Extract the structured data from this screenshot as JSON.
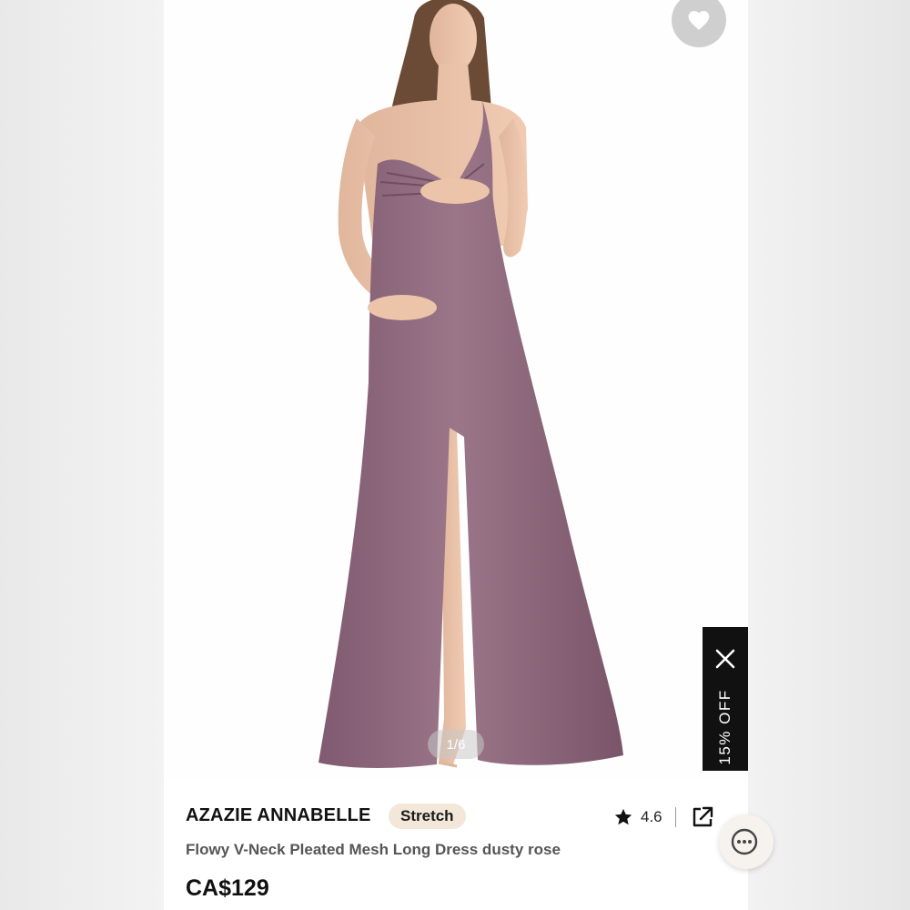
{
  "image_counter": "1/6",
  "promo": {
    "label": "15% OFF"
  },
  "product": {
    "brand": "AZAZIE ANNABELLE",
    "badge": "Stretch",
    "rating": "4.6",
    "title": "Flowy V-Neck Pleated Mesh Long Dress dusty rose",
    "price": "CA$129"
  },
  "icons": {
    "favorite": "heart-icon",
    "close": "close-icon",
    "rating": "star-icon",
    "share": "external-link-icon",
    "chat": "chat-bubble-icon"
  },
  "colors": {
    "dress": "#8f6a80",
    "badge_bg": "#f3e7da",
    "promo_bg": "#111111",
    "fav_bg": "#cfcfcf"
  }
}
